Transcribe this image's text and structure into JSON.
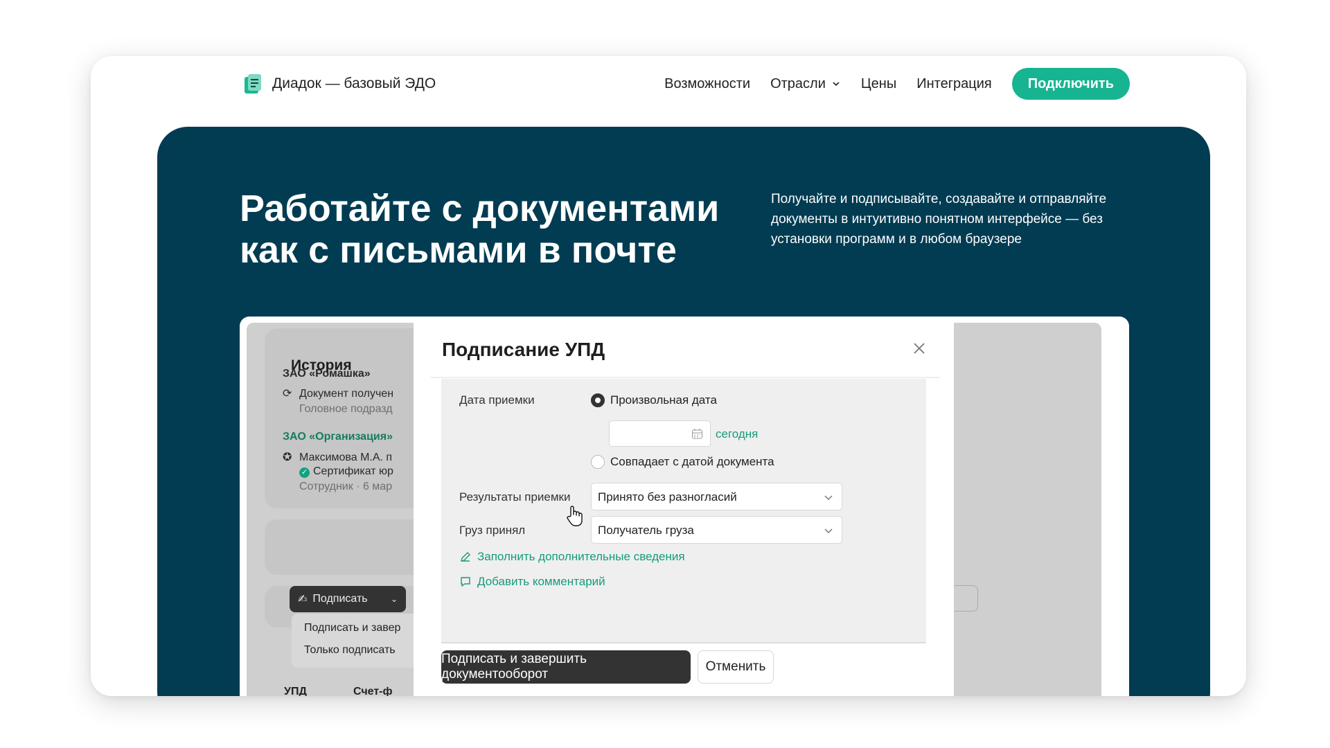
{
  "header": {
    "logo_text": "Диадок — базовый ЭДО",
    "nav": [
      {
        "label": "Возможности"
      },
      {
        "label": "Отрасли",
        "has_dropdown": true
      },
      {
        "label": "Цены"
      },
      {
        "label": "Интеграция"
      }
    ],
    "cta_label": "Подключить"
  },
  "hero": {
    "title_line1": "Работайте с документами",
    "title_line2": "как с письмами в почте",
    "description": "Получайте и подписывайте, создавайте и отправляйте документы в интуитивно понятном интерфейсе — без установки программ и в любом браузере"
  },
  "background_app": {
    "history_title": "История",
    "org1": "ЗАО «Ромашка»",
    "event1_title": "Документ получен",
    "event1_sub": "Головное подразд",
    "org2": "ЗАО «Организация»",
    "event2_title": "Максимова М.А. п",
    "event2_cert": "Сертификат юр",
    "event2_sub": "Сотрудник · 6 мар",
    "sign_button": "Подписать",
    "menu_items": [
      "Подписать и завер",
      "Только подписать"
    ],
    "table_col1": "УПД",
    "table_col2": "Счет-ф"
  },
  "modal": {
    "title": "Подписание УПД",
    "date_label": "Дата приемки",
    "radio_custom_date": "Произвольная дата",
    "date_value": "",
    "today_link": "сегодня",
    "radio_match_doc": "Совпадает с датой документа",
    "results_label": "Результаты приемки",
    "results_value": "Принято без разногласий",
    "cargo_label": "Груз принял",
    "cargo_value": "Получатель груза",
    "fill_extra_link": "Заполнить дополнительные сведения",
    "add_comment_link": "Добавить комментарий",
    "primary_button": "Подписать и завершить документооборот",
    "cancel_button": "Отменить"
  },
  "colors": {
    "accent": "#17b491",
    "hero_bg": "#013c52",
    "link": "#169b7c"
  }
}
